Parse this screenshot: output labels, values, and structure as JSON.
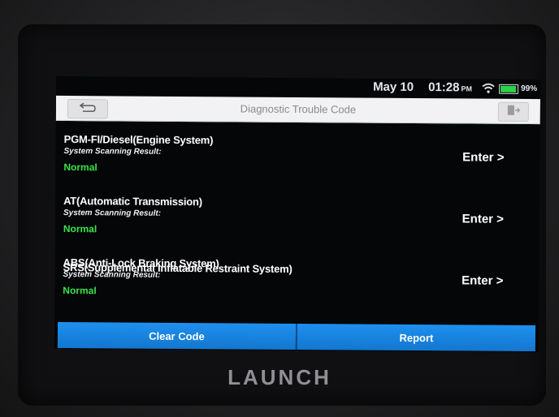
{
  "status_bar": {
    "date": "May 10",
    "time": "01:28",
    "ampm": "PM",
    "battery": "99%"
  },
  "header": {
    "title": "Diagnostic Trouble Code"
  },
  "systems": [
    {
      "name": "PGM-FI/Diesel(Engine System)",
      "result_label": "System Scanning Result:",
      "result": "Normal",
      "action": "Enter >"
    },
    {
      "name": "AT(Automatic Transmission)",
      "result_label": "System Scanning Result:",
      "result": "Normal",
      "action": "Enter >"
    },
    {
      "name": "ABS(Anti-Lock Braking System)",
      "result_label": "System Scanning Result:",
      "result": "Normal",
      "action": "Enter >"
    }
  ],
  "partial_item": "SRS(Supplemental Inflatable Restraint System)",
  "buttons": {
    "clear_code": "Clear Code",
    "report": "Report"
  },
  "brand": "LAUNCH",
  "colors": {
    "accent_blue": "#1a86e6",
    "normal_green": "#38e34a",
    "screen_bg": "#050608"
  }
}
